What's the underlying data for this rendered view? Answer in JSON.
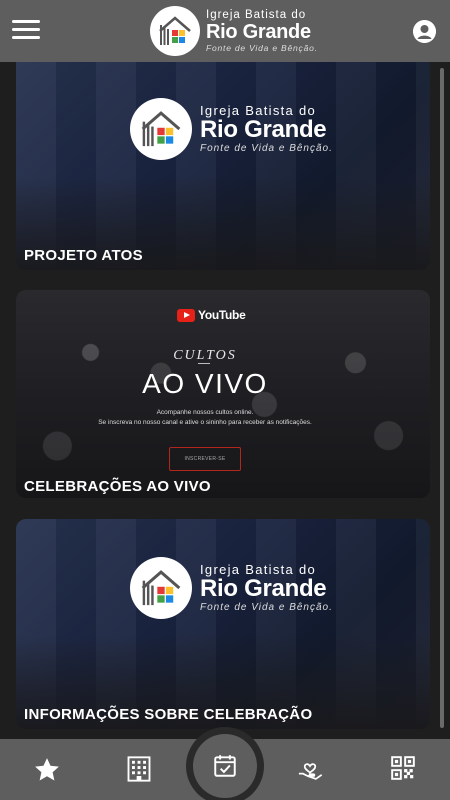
{
  "header": {
    "menu_icon": "hamburger-menu-icon",
    "logo": {
      "line1": "Igreja Batista do",
      "line2": "Rio Grande",
      "line3": "Fonte de Vida e Bênção."
    },
    "account_icon": "account-circle-icon"
  },
  "cards": [
    {
      "title": "PROJETO ATOS",
      "logo": {
        "line1": "Igreja Batista do",
        "line2": "Rio Grande",
        "line3": "Fonte de Vida e Bênção."
      }
    },
    {
      "title": "CELEBRAÇÕES AO VIVO",
      "youtube_label": "YouTube",
      "script_title": "CULTOS",
      "headline": "AO VIVO",
      "subtitle_line1": "Acompanhe nossos cultos online.",
      "subtitle_line2": "Se inscreva no nosso canal e ative o sininho para receber as notificações.",
      "subscribe_label": "INSCREVER-SE"
    },
    {
      "title": "INFORMAÇÕES SOBRE CELEBRAÇÃO",
      "logo": {
        "line1": "Igreja Batista do",
        "line2": "Rio Grande",
        "line3": "Fonte de Vida e Bênção."
      }
    }
  ],
  "bottom_nav": {
    "items": [
      "star-icon",
      "building-icon",
      "calendar-check-icon",
      "hand-heart-icon",
      "qr-code-icon"
    ]
  },
  "colors": {
    "header_bg": "#5e5e5e",
    "content_bg": "#1e1e1e",
    "logo_roof": "#ffffff",
    "logo_red": "#e53935",
    "logo_yellow": "#fbc02d",
    "logo_green": "#43a047",
    "logo_blue": "#1e88e5"
  }
}
